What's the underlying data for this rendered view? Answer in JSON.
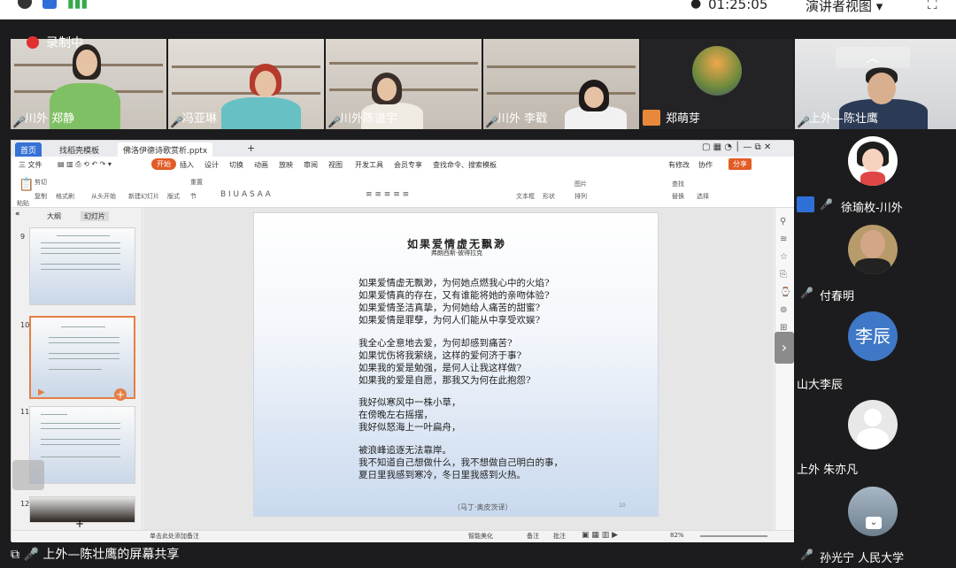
{
  "system": {
    "clock": "01:25:05",
    "view_mode": "演讲者视图",
    "view_chevron": "▾"
  },
  "recording": {
    "label": "录制中"
  },
  "participants_top": [
    {
      "name": "川外 郑静"
    },
    {
      "name": "冯亚琳"
    },
    {
      "name": "川外陈道宇"
    },
    {
      "name": "川外 李戳"
    },
    {
      "name": "郑萌芽"
    },
    {
      "name": "上外—陈壮鹰"
    }
  ],
  "participants_side": [
    {
      "name": "徐瑜枚-川外"
    },
    {
      "name": "付春明"
    },
    {
      "name": "山大李辰",
      "avatar_text": "李辰"
    },
    {
      "name": "上外 朱亦凡"
    },
    {
      "name": "孙光宁 人民大学"
    }
  ],
  "wps": {
    "tabs": [
      "首页",
      "找稻壳模板",
      "佛洛伊德诗歌赏析.pptx"
    ],
    "menu": [
      "三 文件",
      "开始",
      "插入",
      "设计",
      "切换",
      "动画",
      "放映",
      "审阅",
      "视图",
      "开发工具",
      "会员专享",
      "查找命令、搜索模板",
      "有修改",
      "协作",
      "分享"
    ],
    "ribbon": [
      "剪切",
      "复制",
      "格式刷",
      "粘贴",
      "从头开始",
      "新建幻灯片",
      "版式",
      "节",
      "重置",
      "文本框",
      "形状",
      "图片",
      "排列",
      "查找",
      "替换",
      "选择"
    ],
    "thumb_tabs": [
      "大纲",
      "幻灯片"
    ],
    "thumb_numbers": [
      "9",
      "10",
      "11",
      "12"
    ],
    "status": {
      "notes": "单击此处添加备注",
      "smart": "智能美化",
      "note_btn": "备注",
      "comment_btn": "批注",
      "zoom": "82%"
    }
  },
  "slide": {
    "title": "如果爱情虚无飘渺",
    "subtitle": "弗朗西斯·彼得拉克",
    "stanzas": [
      [
        "如果爱情虚无飘渺，为何她点燃我心中的火焰?",
        "如果爱情真的存在，又有谁能将她的亲吻体验?",
        "如果爱情圣洁真挚，为何她给人痛苦的甜蜜?",
        "如果爱情是罪孽，为何人们能从中享受欢娱?"
      ],
      [
        "我全心全意地去爱，为何却感到痛苦?",
        "如果忧伤将我萦绕，这样的爱何济于事?",
        "如果我的爱是勉强，是何人让我这样做?",
        "如果我的爱是自愿，那我又为何在此抱怨?"
      ],
      [
        "我好似寒风中一株小草，",
        "在傍晚左右摇摆，",
        "我好似怒海上一叶扁舟，"
      ],
      [
        "被浪峰追逐无法靠岸。",
        "我不知道自己想做什么，我不想做自己明白的事，",
        "夏日里我感到寒冷，冬日里我感到火热。"
      ]
    ],
    "credit": "（马丁·奥皮茨译）",
    "page": "10"
  },
  "share": {
    "label": "上外—陈壮鹰的屏幕共享"
  },
  "colors": {
    "accent": "#e25c26",
    "meeting_bg": "#1c1c1e",
    "avatar_blue": "#3f78c7"
  }
}
